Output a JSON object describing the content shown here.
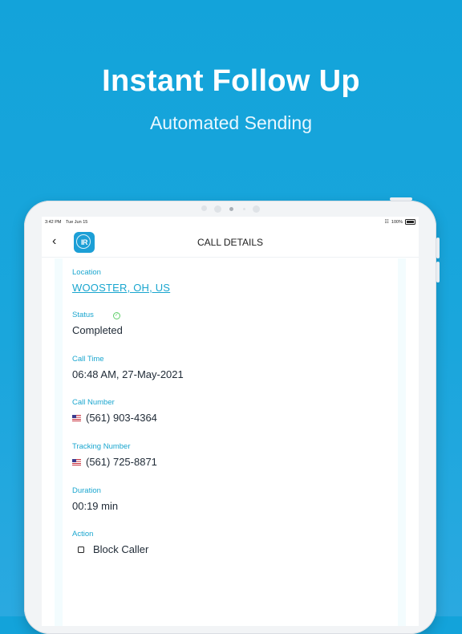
{
  "hero": {
    "title": "Instant Follow Up",
    "subtitle": "Automated Sending"
  },
  "status_bar": {
    "time": "3:42 PM",
    "date": "Tue Jun 15",
    "battery": "100%"
  },
  "nav": {
    "title": "CALL DETAILS",
    "logo_text": "IR"
  },
  "details": {
    "location": {
      "label": "Location",
      "value": "WOOSTER, OH, US"
    },
    "status": {
      "label": "Status",
      "value": "Completed"
    },
    "call_time": {
      "label": "Call Time",
      "value": "06:48 AM, 27-May-2021"
    },
    "call_number": {
      "label": "Call Number",
      "value": "(561) 903-4364"
    },
    "tracking_number": {
      "label": "Tracking Number",
      "value": "(561) 725-8871"
    },
    "duration": {
      "label": "Duration",
      "value": "00:19 min"
    },
    "action": {
      "label": "Action",
      "value": "Block Caller"
    }
  },
  "colors": {
    "background": "#13a3da",
    "accent": "#1aa6cf",
    "success": "#5fcf6a",
    "text": "#1f2a36"
  },
  "icons": [
    "back-chevron-icon",
    "app-logo-icon",
    "wifi-icon",
    "battery-icon",
    "check-circle-icon",
    "us-flag-icon",
    "checkbox-icon"
  ]
}
